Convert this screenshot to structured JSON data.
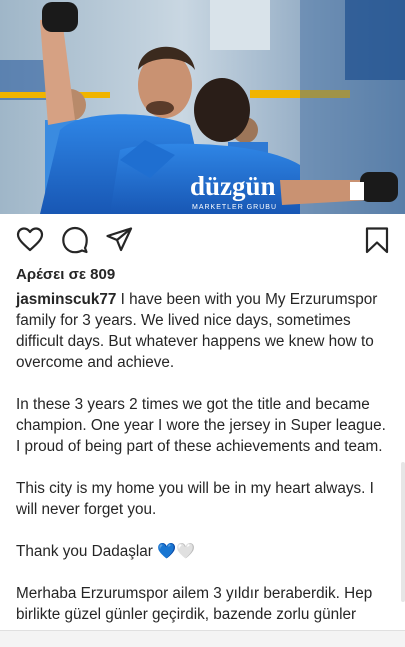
{
  "post": {
    "photo": {
      "sponsor_main": "düzgün",
      "sponsor_sub": "MARKETLER GRUBU",
      "colors": {
        "jersey": "#1f6fd1",
        "sky": "#cfe3f1",
        "stand": "#f0b400"
      }
    },
    "actions": {
      "like": "heart-icon",
      "comment": "comment-icon",
      "share": "share-icon",
      "save": "bookmark-icon"
    },
    "likes_text": "Αρέσει σε 809",
    "username": "jasminscuk77",
    "caption": {
      "p1": "I have been with you My Erzurumspor family for 3 years. We lived nice days, sometimes difficult days. But whatever happens we knew how to overcome and achieve.",
      "p2": "In these 3 years 2 times we got the title and became champion. One year I wore the jersey in Super league. I proud of being part of these achievements and team.",
      "p3": "This city is my home you will be in my heart always. I will never forget you.",
      "p4": "Thank you Dadaşlar 💙🤍",
      "p5": "Merhaba Erzurumspor ailem 3 yıldır beraberdik. Hep birlikte güzel günler geçirdik, bazende zorlu günler"
    }
  }
}
